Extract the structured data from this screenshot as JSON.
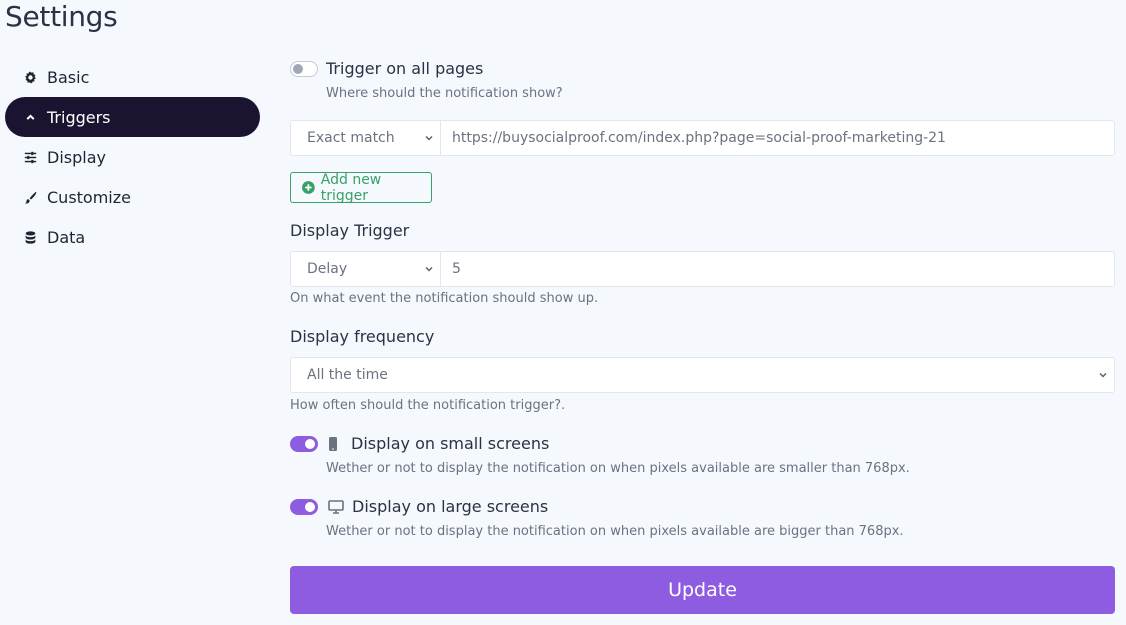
{
  "page": {
    "title": "Settings"
  },
  "sidebar": {
    "items": [
      {
        "label": "Basic",
        "icon": "gear-icon",
        "active": false
      },
      {
        "label": "Triggers",
        "icon": "chevron-up-icon",
        "active": true
      },
      {
        "label": "Display",
        "icon": "sliders-icon",
        "active": false
      },
      {
        "label": "Customize",
        "icon": "paintbrush-icon",
        "active": false
      },
      {
        "label": "Data",
        "icon": "database-icon",
        "active": false
      }
    ]
  },
  "triggers": {
    "all_pages": {
      "label": "Trigger on all pages",
      "help": "Where should the notification show?",
      "enabled": false
    },
    "rule": {
      "match_type": "Exact match",
      "url": "https://buysocialproof.com/index.php?page=social-proof-marketing-21"
    },
    "add_button_label": "Add new trigger"
  },
  "display_trigger": {
    "label": "Display Trigger",
    "type": "Delay",
    "value": "5",
    "help": "On what event the notification should show up."
  },
  "display_frequency": {
    "label": "Display frequency",
    "value": "All the time",
    "help": "How often should the notification trigger?."
  },
  "small_screens": {
    "label": "Display on small screens",
    "icon": "mobile-icon",
    "enabled": true,
    "help": "Wether or not to display the notification on when pixels available are smaller than 768px."
  },
  "large_screens": {
    "label": "Display on large screens",
    "icon": "desktop-icon",
    "enabled": true,
    "help": "Wether or not to display the notification on when pixels available are bigger than 768px."
  },
  "update_button_label": "Update",
  "colors": {
    "accent": "#8e5ce0",
    "success": "#38a169",
    "nav_active": "#1b1430"
  }
}
